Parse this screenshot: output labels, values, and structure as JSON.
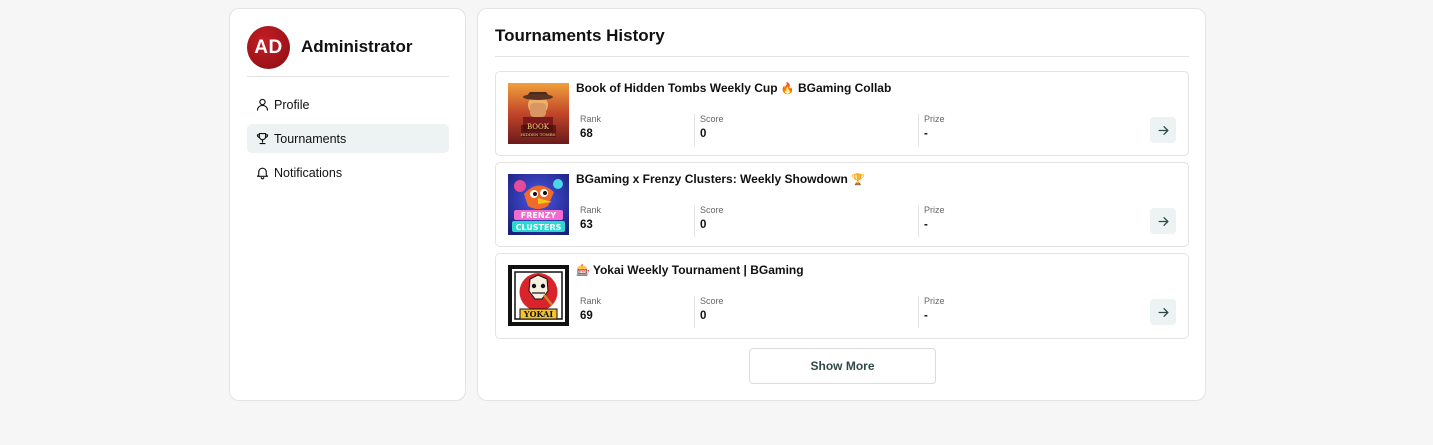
{
  "user": {
    "initials": "AD",
    "name": "Administrator",
    "avatar_color": "#a3141a"
  },
  "nav": {
    "items": [
      {
        "label": "Profile",
        "icon": "user-icon"
      },
      {
        "label": "Tournaments",
        "icon": "trophy-icon",
        "active": true
      },
      {
        "label": "Notifications",
        "icon": "bell-icon"
      }
    ]
  },
  "main": {
    "title": "Tournaments History",
    "stat_labels": {
      "rank": "Rank",
      "score": "Score",
      "prize": "Prize"
    },
    "tournaments": [
      {
        "title": "Book of Hidden Tombs Weekly Cup",
        "emoji": "🔥",
        "title_suffix": "BGaming Collab",
        "rank": "68",
        "score": "0",
        "prize": "-",
        "thumb_icon": "book-of-hidden-tombs-game-icon"
      },
      {
        "title": "BGaming x Frenzy Clusters: Weekly Showdown",
        "emoji": "🏆",
        "rank": "63",
        "score": "0",
        "prize": "-",
        "thumb_icon": "frenzy-clusters-game-icon"
      },
      {
        "emoji": "🎰",
        "title": "Yokai Weekly Tournament | BGaming",
        "rank": "69",
        "score": "0",
        "prize": "-",
        "thumb_icon": "yokai-game-icon"
      }
    ],
    "show_more_label": "Show More"
  },
  "colors": {
    "accent_bg": "#edf3f2",
    "button_text": "#2f4a46",
    "page_bg": "#f6f6f6"
  }
}
